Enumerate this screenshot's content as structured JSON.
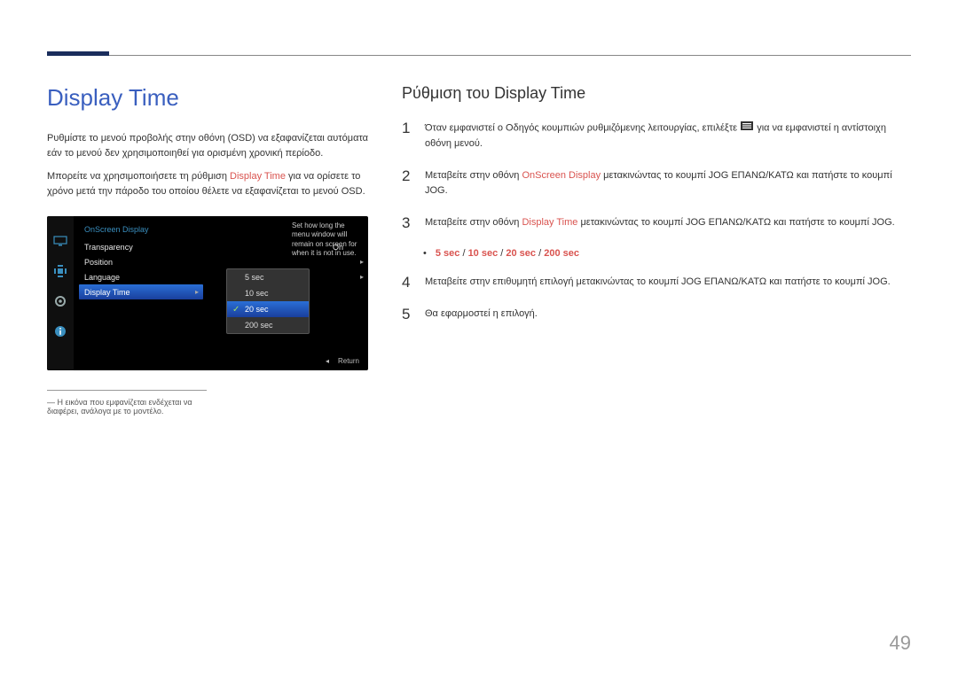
{
  "page_number": "49",
  "left": {
    "title": "Display Time",
    "para1": "Ρυθμίστε το μενού προβολής στην οθόνη (OSD) να εξαφανίζεται αυτόματα εάν το μενού δεν χρησιμοποιηθεί για ορισμένη χρονική περίοδο.",
    "para2_a": "Μπορείτε να χρησιμοποιήσετε τη ρύθμιση ",
    "para2_hl": "Display Time",
    "para2_b": " για να ορίσετε το χρόνο μετά την πάροδο του οποίου θέλετε να εξαφανίζεται το μενού OSD.",
    "footnote_prefix": "― ",
    "footnote": "Η εικόνα που εμφανίζεται ενδέχεται να διαφέρει, ανάλογα με το μοντέλο."
  },
  "osd": {
    "title": "OnScreen Display",
    "items": [
      {
        "label": "Transparency",
        "value": "On",
        "arrow": ""
      },
      {
        "label": "Position",
        "value": "",
        "arrow": "▸"
      },
      {
        "label": "Language",
        "value": "",
        "arrow": "▸"
      },
      {
        "label": "Display Time",
        "value": "",
        "arrow": "▸",
        "active": true
      }
    ],
    "options": [
      {
        "label": "5 sec"
      },
      {
        "label": "10 sec"
      },
      {
        "label": "20 sec",
        "selected": true
      },
      {
        "label": "200 sec"
      }
    ],
    "help": "Set how long the menu window will remain on screen for when it is not in use.",
    "return": "Return"
  },
  "right": {
    "subtitle": "Ρύθμιση του Display Time",
    "step1_a": "Όταν εμφανιστεί ο Οδηγός κουμπιών ρυθμιζόμενης λειτουργίας, επιλέξτε ",
    "step1_b": " για να εμφανιστεί η αντίστοιχη οθόνη μενού.",
    "step2_a": "Μεταβείτε στην οθόνη ",
    "step2_hl": "OnScreen Display",
    "step2_b": " μετακινώντας το κουμπί JOG ΕΠΑΝΩ/ΚΑΤΩ και πατήστε το κουμπί JOG.",
    "step3_a": "Μεταβείτε στην οθόνη ",
    "step3_hl": "Display Time",
    "step3_b": " μετακινώντας το κουμπί JOG ΕΠΑΝΩ/ΚΑΤΩ και πατήστε το κουμπί JOG.",
    "opts": {
      "o1": "5 sec",
      "s1": " / ",
      "o2": "10 sec",
      "s2": " / ",
      "o3": "20 sec",
      "s3": " / ",
      "o4": "200 sec"
    },
    "step4": "Μεταβείτε στην επιθυμητή επιλογή μετακινώντας το κουμπί JOG ΕΠΑΝΩ/ΚΑΤΩ και πατήστε το κουμπί JOG.",
    "step5": "Θα εφαρμοστεί η επιλογή."
  }
}
